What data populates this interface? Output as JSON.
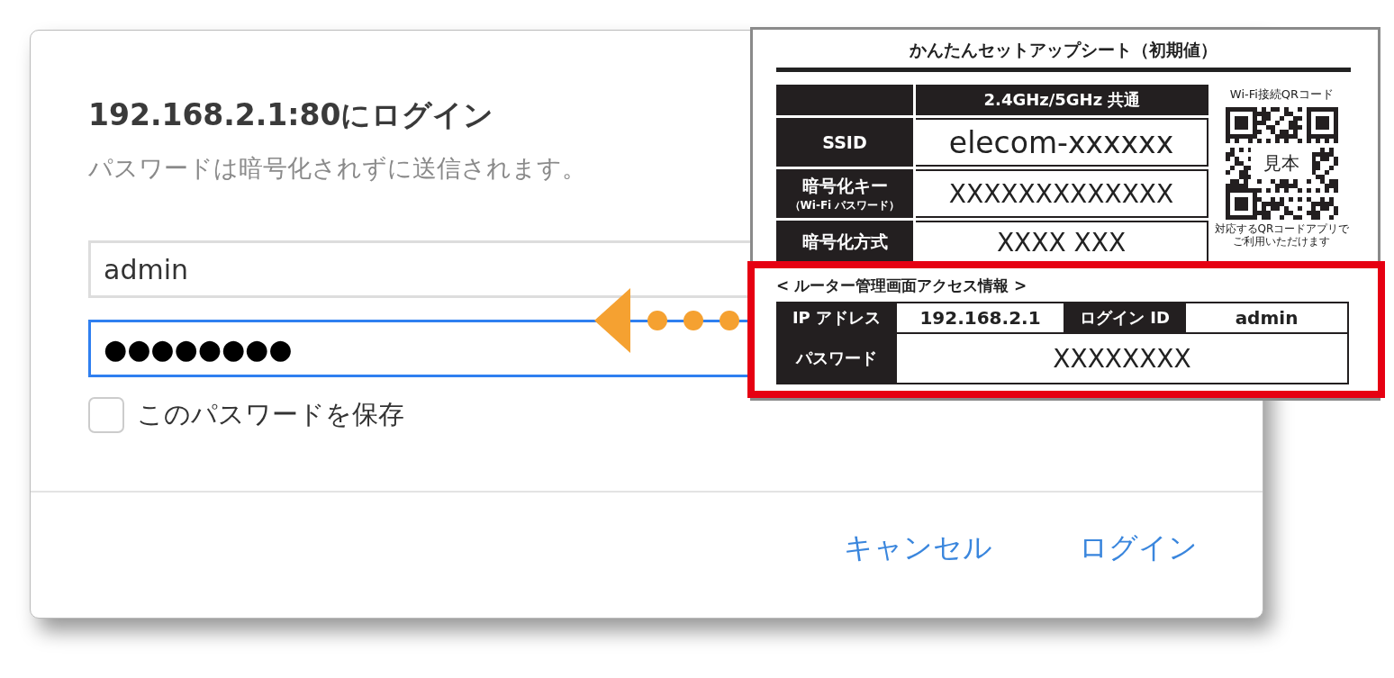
{
  "dialog": {
    "title": "192.168.2.1:80にログイン",
    "warning": "パスワードは暗号化されずに送信されます。",
    "username": {
      "value": "admin"
    },
    "password": {
      "value": "●●●●●●●●",
      "focused": true
    },
    "save_password": {
      "label": "このパスワードを保存",
      "checked": false
    },
    "buttons": [
      {
        "label": "キャンセル"
      },
      {
        "label": "ログイン"
      }
    ]
  },
  "setup_sheet": {
    "title": "かんたんセットアップシート（初期値）",
    "band_header": "2.4GHz/5GHz 共通",
    "rows": [
      {
        "label": "SSID",
        "value": "elecom-xxxxxx"
      },
      {
        "label": "暗号化キー",
        "sublabel": "（Wi-Fi パスワード）",
        "value": "XXXXXXXXXXXXX"
      },
      {
        "label": "暗号化方式",
        "value": "XXXX XXX"
      }
    ],
    "qr": {
      "caption": "Wi-Fi接続QRコード",
      "stamp": "見本",
      "note_lines": [
        "対応するQRコードアプリで",
        "ご利用いただけます"
      ]
    },
    "router_access": {
      "heading": "< ルーター管理画面アクセス情報 >",
      "ip_label": "IP アドレス",
      "ip": "192.168.2.1",
      "login_id_label": "ログイン ID",
      "login_id": "admin",
      "password_label": "パスワード",
      "password": "XXXXXXXX"
    }
  }
}
